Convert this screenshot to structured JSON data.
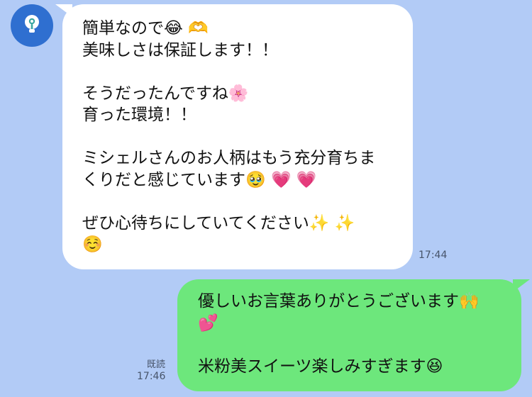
{
  "avatar": {
    "icon": "lightbulb-icon",
    "color": "#2f6fd0"
  },
  "incoming": {
    "lines": [
      "簡単なので😂 🫶",
      "美味しさは保証します！！",
      "",
      "そうだったんですね🌸",
      "育った環境！！",
      "",
      "ミシェルさんのお人柄はもう充分育ちま",
      "くりだと感じています🥹 💗 💗",
      "",
      "ぜひ心待ちにしていてください✨ ✨",
      "☺️"
    ],
    "time": "17:44"
  },
  "outgoing": {
    "lines": [
      "優しいお言葉ありがとうございます🙌",
      "💕",
      "",
      "米粉美スイーツ楽しみすぎます😆"
    ],
    "read_label": "既読",
    "time": "17:46"
  },
  "colors": {
    "background": "#b2cbf6",
    "incoming_bubble": "#ffffff",
    "outgoing_bubble": "#6de77c"
  }
}
